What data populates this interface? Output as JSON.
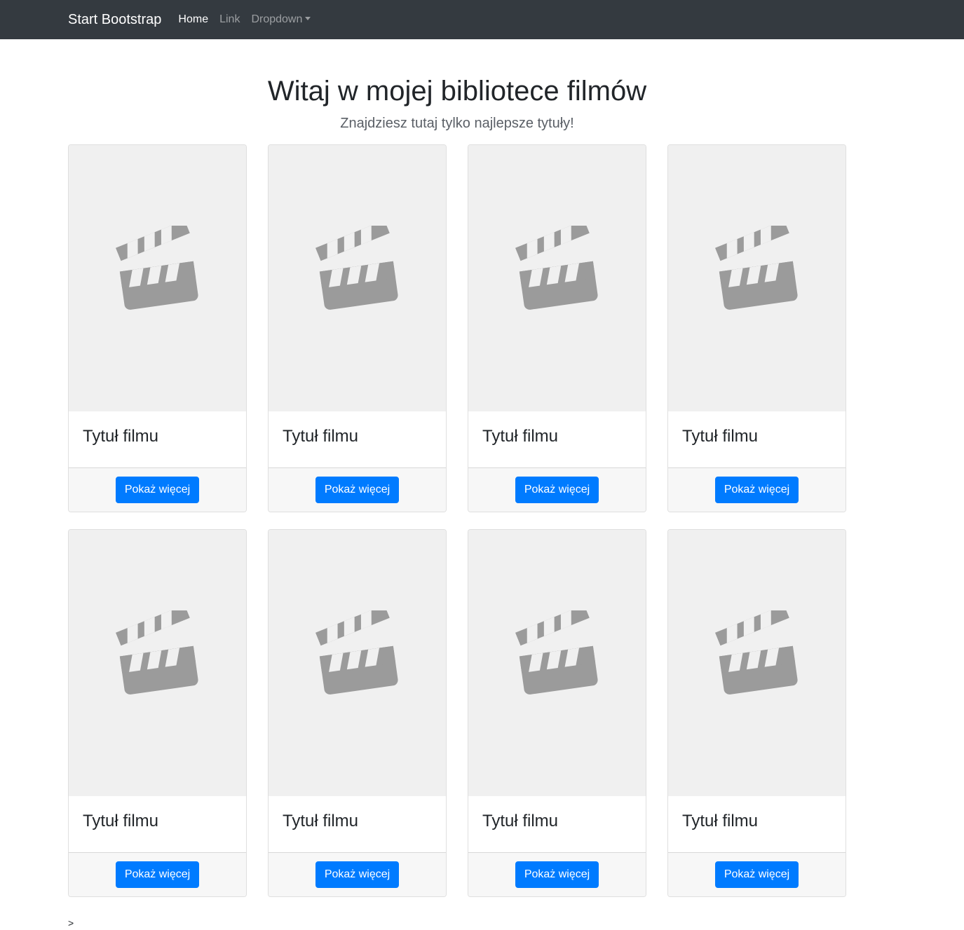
{
  "navbar": {
    "brand": "Start Bootstrap",
    "links": [
      {
        "label": "Home"
      },
      {
        "label": "Link"
      },
      {
        "label": "Dropdown"
      }
    ]
  },
  "hero": {
    "title": "Witaj w mojej bibliotece filmów",
    "subtitle": "Znajdziesz tutaj tylko najlepsze tytuły!"
  },
  "cards": [
    {
      "title": "Tytuł filmu",
      "button": "Pokaż więcej",
      "icon": "clapperboard-icon"
    },
    {
      "title": "Tytuł filmu",
      "button": "Pokaż więcej",
      "icon": "clapperboard-icon"
    },
    {
      "title": "Tytuł filmu",
      "button": "Pokaż więcej",
      "icon": "clapperboard-icon"
    },
    {
      "title": "Tytuł filmu",
      "button": "Pokaż więcej",
      "icon": "clapperboard-icon"
    },
    {
      "title": "Tytuł filmu",
      "button": "Pokaż więcej",
      "icon": "clapperboard-icon"
    },
    {
      "title": "Tytuł filmu",
      "button": "Pokaż więcej",
      "icon": "clapperboard-icon"
    },
    {
      "title": "Tytuł filmu",
      "button": "Pokaż więcej",
      "icon": "clapperboard-icon"
    },
    {
      "title": "Tytuł filmu",
      "button": "Pokaż więcej",
      "icon": "clapperboard-icon"
    }
  ],
  "footer_text": ">",
  "colors": {
    "navbar_bg": "#343a40",
    "button_primary": "#007bff",
    "placeholder_bg": "#f0f0f0",
    "icon_gray": "#9b9b9b"
  }
}
